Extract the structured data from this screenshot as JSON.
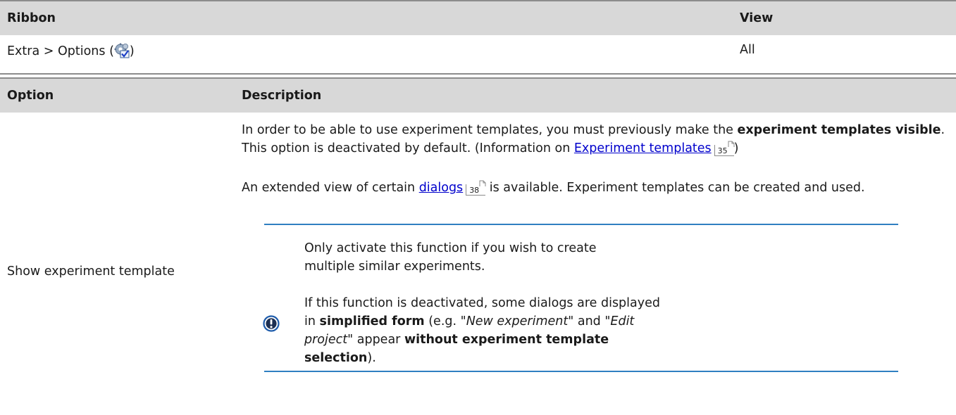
{
  "ribbon_table": {
    "col_ribbon": "Ribbon",
    "col_view": "View",
    "row": {
      "ribbon_prefix": "Extra > Options (",
      "ribbon_suffix": ")",
      "ribbon_icon": "options-gear-check-icon",
      "view": "All"
    }
  },
  "option_table": {
    "col_option": "Option",
    "col_description": "Description",
    "row": {
      "option": "Show experiment template",
      "para1": {
        "t1": "In order to be able to use experiment templates, you must previously make the ",
        "b1": "experiment templates visible",
        "t2": ". This option is deactivated by default. (Information on ",
        "link": "Experiment templates",
        "page": "35",
        "t3": ")"
      },
      "para2": {
        "t1": "An extended view of certain ",
        "link": "dialogs",
        "page": "38",
        "t2": " is available. Experiment templates can be created and used."
      },
      "note": {
        "icon": "important-exclamation-icon",
        "accent_color": "#2f7fc1",
        "p1": "Only activate this function if you wish to create multiple similar experiments.",
        "p2": {
          "t1": "If this function is deactivated, some dialogs are displayed in ",
          "b1": "simplified form",
          "t2": " (e.g. \"",
          "i1": "New experiment",
          "t3": "\" and \"",
          "i2": "Edit project",
          "t4": "\" appear ",
          "b2": "without experiment template selection",
          "t5": ")."
        }
      }
    }
  }
}
